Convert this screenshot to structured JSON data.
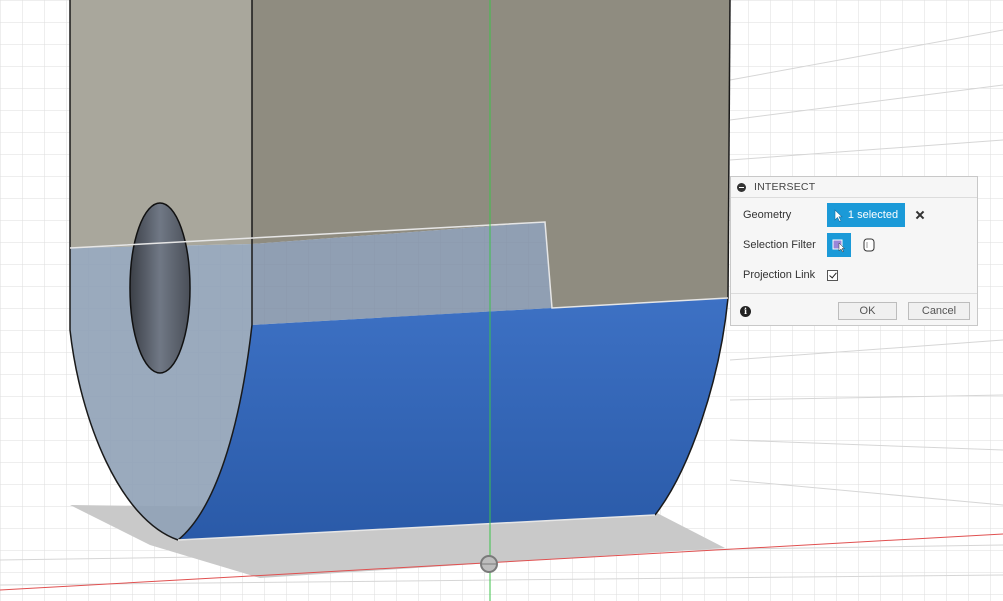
{
  "dialog": {
    "title": "INTERSECT",
    "geometry": {
      "label": "Geometry",
      "value": "1 selected"
    },
    "selection_filter": {
      "label": "Selection Filter"
    },
    "projection_link": {
      "label": "Projection Link",
      "checked": true
    },
    "ok_label": "OK",
    "cancel_label": "Cancel"
  },
  "colors": {
    "accent": "#1b9ad8",
    "selected_face": "#2d62b6",
    "body_gray": "#a8a598",
    "x_axis": "#e04040",
    "y_axis": "#40c040"
  },
  "icons": {
    "collapse": "collapse-icon",
    "cursor": "cursor-arrow-icon",
    "clear": "close-icon",
    "filter_face": "face-filter-icon",
    "filter_body": "body-filter-icon",
    "info": "info-icon",
    "origin": "origin-icon"
  }
}
